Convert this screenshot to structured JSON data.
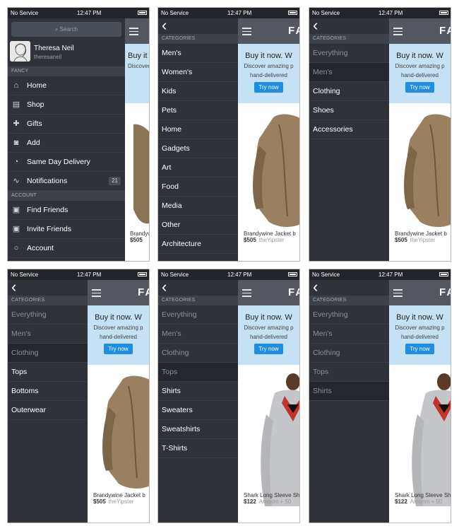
{
  "status": {
    "carrier": "No Service",
    "time": "12:47 PM"
  },
  "root_panel": {
    "search_placeholder": "Search",
    "user": {
      "name": "Theresa Neil",
      "handle": "theresaneil"
    },
    "section_fancy": "FANCY",
    "nav": [
      {
        "icon": "home-icon",
        "glyph": "⌂",
        "label": "Home"
      },
      {
        "icon": "shop-icon",
        "glyph": "▤",
        "label": "Shop"
      },
      {
        "icon": "gift-icon",
        "glyph": "✚",
        "label": "Gifts"
      },
      {
        "icon": "camera-icon",
        "glyph": "◙",
        "label": "Add"
      },
      {
        "icon": "clock-icon",
        "glyph": "◔",
        "label": "Same Day Delivery"
      },
      {
        "icon": "pulse-icon",
        "glyph": "∿",
        "label": "Notifications",
        "badge": "21"
      }
    ],
    "section_account": "ACCOUNT",
    "account": [
      {
        "icon": "find-friends-icon",
        "glyph": "▣",
        "label": "Find Friends"
      },
      {
        "icon": "invite-friends-icon",
        "glyph": "▣",
        "label": "Invite Friends"
      },
      {
        "icon": "user-icon",
        "glyph": "○",
        "label": "Account"
      }
    ]
  },
  "categories_header": "CATEGORIES",
  "brand_logo": "FA",
  "promo": {
    "title": "Buy it now. W",
    "line1": "Discover amazing p",
    "line2": "hand-delivered",
    "button": "Try now"
  },
  "products": {
    "jacket": {
      "name": "Brandywine Jacket b",
      "price": "$505",
      "meta": "theYipster"
    },
    "shirt": {
      "name": "Shark Long Sleeve Sh",
      "price": "$122",
      "meta": "Amorim + 50"
    }
  },
  "panels": [
    {
      "items": [
        {
          "label": "Men's",
          "state": "active"
        },
        {
          "label": "Women's",
          "state": "active"
        },
        {
          "label": "Kids",
          "state": "active"
        },
        {
          "label": "Pets",
          "state": "active"
        },
        {
          "label": "Home",
          "state": "active"
        },
        {
          "label": "Gadgets",
          "state": "active"
        },
        {
          "label": "Art",
          "state": "active"
        },
        {
          "label": "Food",
          "state": "active"
        },
        {
          "label": "Media",
          "state": "active"
        },
        {
          "label": "Other",
          "state": "active"
        },
        {
          "label": "Architecture",
          "state": "active"
        }
      ]
    },
    {
      "items": [
        {
          "label": "Everything",
          "state": "muted"
        },
        {
          "label": "Men's",
          "state": "sel"
        },
        {
          "label": "Clothing",
          "state": "active"
        },
        {
          "label": "Shoes",
          "state": "active"
        },
        {
          "label": "Accessories",
          "state": "active"
        }
      ]
    },
    {
      "items": [
        {
          "label": "Everything",
          "state": "muted"
        },
        {
          "label": "Men's",
          "state": "muted"
        },
        {
          "label": "Clothing",
          "state": "sel"
        },
        {
          "label": "Tops",
          "state": "active"
        },
        {
          "label": "Bottoms",
          "state": "active"
        },
        {
          "label": "Outerwear",
          "state": "active"
        }
      ]
    },
    {
      "items": [
        {
          "label": "Everything",
          "state": "muted"
        },
        {
          "label": "Men's",
          "state": "muted"
        },
        {
          "label": "Clothing",
          "state": "muted"
        },
        {
          "label": "Tops",
          "state": "sel"
        },
        {
          "label": "Shirts",
          "state": "active"
        },
        {
          "label": "Sweaters",
          "state": "active"
        },
        {
          "label": "Sweatshirts",
          "state": "active"
        },
        {
          "label": "T-Shirts",
          "state": "active"
        }
      ]
    },
    {
      "items": [
        {
          "label": "Everything",
          "state": "muted"
        },
        {
          "label": "Men's",
          "state": "muted"
        },
        {
          "label": "Clothing",
          "state": "muted"
        },
        {
          "label": "Tops",
          "state": "muted"
        },
        {
          "label": "Shirts",
          "state": "sel"
        }
      ]
    }
  ]
}
